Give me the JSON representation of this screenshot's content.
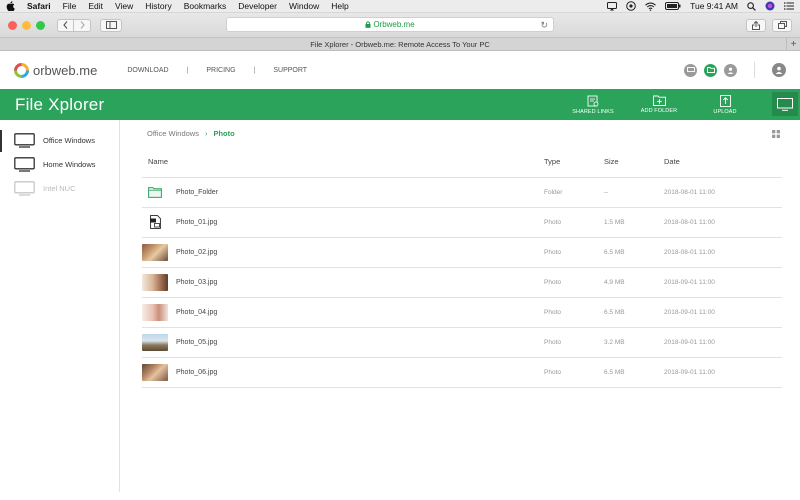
{
  "menubar": {
    "app": "Safari",
    "items": [
      "File",
      "Edit",
      "View",
      "History",
      "Bookmarks",
      "Developer",
      "Window",
      "Help"
    ],
    "clock": "Tue 9:41 AM"
  },
  "browser": {
    "url": "Orbweb.me",
    "tab_title": "File Xplorer - Orbweb.me: Remote Access To Your PC"
  },
  "site": {
    "logo": "orbweb.me",
    "nav": [
      "DOWNLOAD",
      "PRICING",
      "SUPPORT"
    ]
  },
  "app": {
    "title": "File Xplorer",
    "actions": {
      "shared_links": "SHARED LINKS",
      "add_folder": "ADD FOLDER",
      "upload": "UPLOAD"
    }
  },
  "devices": [
    {
      "label": "Office Windows",
      "state": "active"
    },
    {
      "label": "Home Windows",
      "state": "normal"
    },
    {
      "label": "Intel NUC",
      "state": "disabled"
    }
  ],
  "breadcrumb": {
    "root": "Office Windows",
    "current": "Photo"
  },
  "table": {
    "headers": {
      "name": "Name",
      "type": "Type",
      "size": "Size",
      "date": "Date"
    },
    "rows": [
      {
        "name": "Photo_Folder",
        "type": "Folder",
        "size": "--",
        "date": "2018-08-01 11:00",
        "icon": "folder-icon"
      },
      {
        "name": "Photo_01.jpg",
        "type": "Photo",
        "size": "1.5 MB",
        "date": "2018-08-01 11:00",
        "icon": "image-file-icon"
      },
      {
        "name": "Photo_02.jpg",
        "type": "Photo",
        "size": "6.5 MB",
        "date": "2018-08-01 11:00",
        "icon": "photo-thumbnail"
      },
      {
        "name": "Photo_03.jpg",
        "type": "Photo",
        "size": "4.9 MB",
        "date": "2018-09-01 11:00",
        "icon": "photo-thumbnail"
      },
      {
        "name": "Photo_04.jpg",
        "type": "Photo",
        "size": "6.5 MB",
        "date": "2018-09-01 11:00",
        "icon": "photo-thumbnail"
      },
      {
        "name": "Photo_05.jpg",
        "type": "Photo",
        "size": "3.2 MB",
        "date": "2018-09-01 11:00",
        "icon": "photo-thumbnail"
      },
      {
        "name": "Photo_06.jpg",
        "type": "Photo",
        "size": "6.5 MB",
        "date": "2018-09-01 11:00",
        "icon": "photo-thumbnail"
      }
    ]
  },
  "colors": {
    "brand_green": "#2ca35b",
    "brand_green_dark": "#248b4c"
  }
}
